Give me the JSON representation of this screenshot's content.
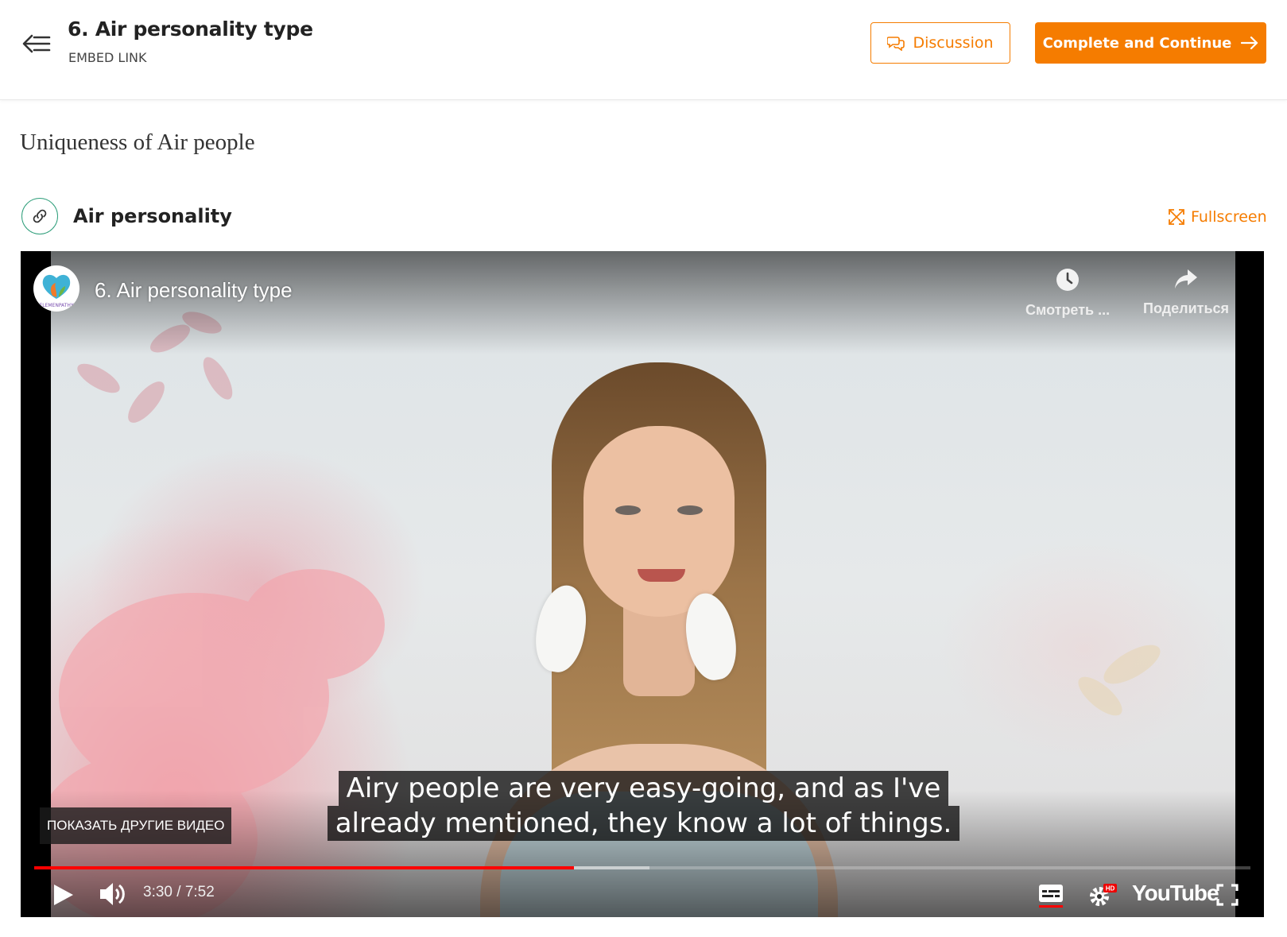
{
  "header": {
    "lesson_title": "6. Air personality type",
    "lesson_subtitle": "EMBED LINK",
    "discussion_label": "Discussion",
    "complete_label": "Complete and Continue",
    "accent_color": "#f57c00"
  },
  "content": {
    "section_heading": "Uniqueness of Air people",
    "embed_title": "Air personality",
    "fullscreen_label": "Fullscreen"
  },
  "video": {
    "title": "6. Air personality type",
    "channel_avatar_text": "ELEMENPATHY",
    "watch_later_label": "Смотреть ...",
    "share_label": "Поделиться",
    "more_videos_label": "ПОКАЗАТЬ ДРУГИЕ ВИДЕО",
    "caption_line1": "Airy people are very easy-going, and as I've",
    "caption_line2": "already mentioned, they know a lot of things.",
    "time": "3:30 / 7:52",
    "played_fraction": 0.444,
    "buffered_fraction": 0.506,
    "hd_badge": "HD",
    "youtube_label": "YouTube",
    "progress_color": "#ff0000"
  }
}
